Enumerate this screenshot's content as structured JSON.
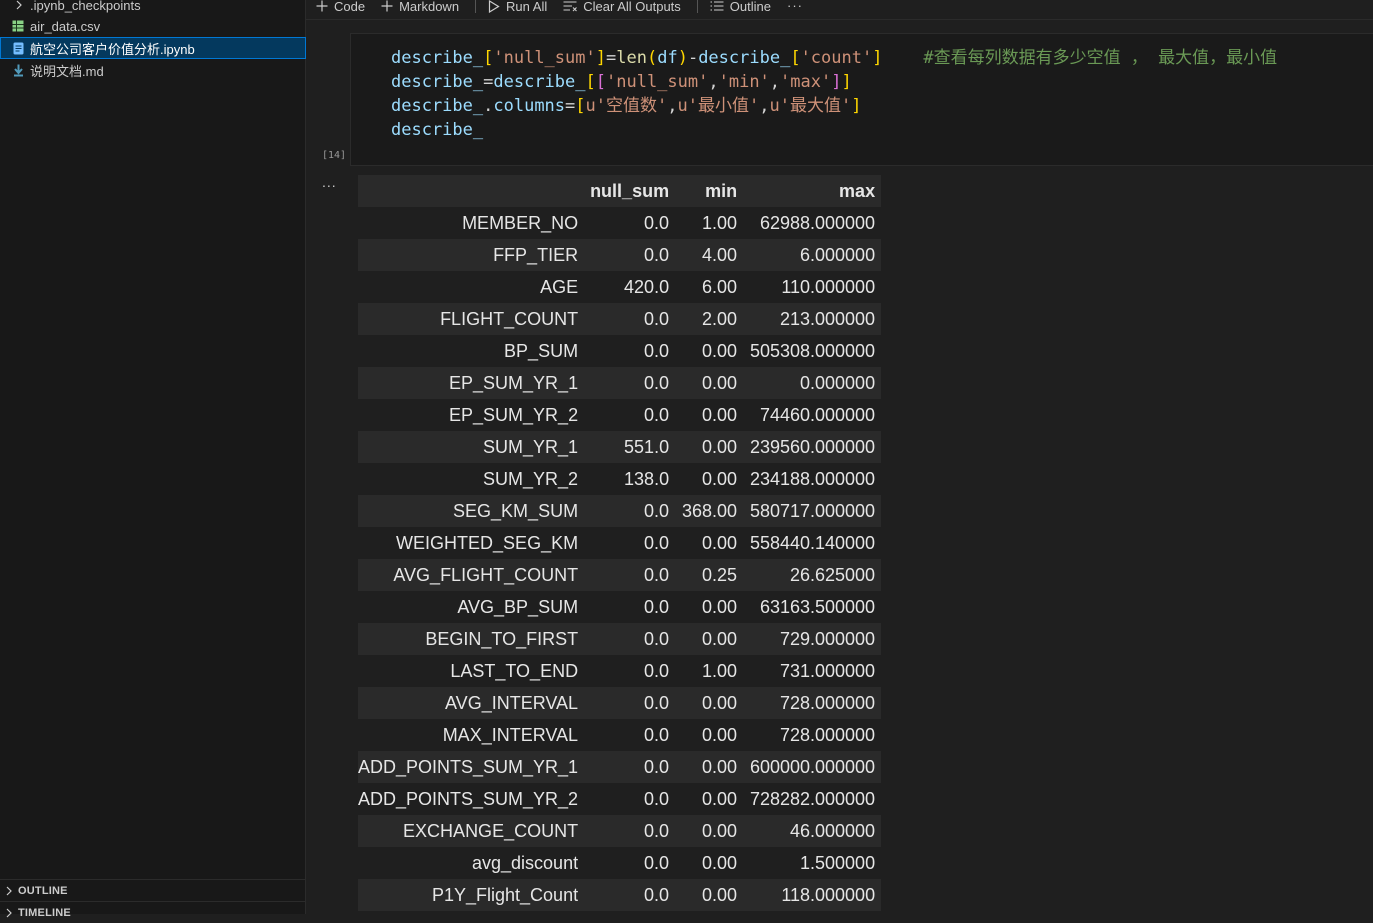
{
  "sidebar": {
    "files": [
      {
        "name": ".ipynb_checkpoints",
        "kind": "folder"
      },
      {
        "name": "air_data.csv",
        "kind": "csv"
      },
      {
        "name": "航空公司客户价值分析.ipynb",
        "kind": "notebook",
        "selected": true
      },
      {
        "name": "说明文档.md",
        "kind": "markdown"
      }
    ],
    "panels": [
      "OUTLINE",
      "TIMELINE"
    ]
  },
  "toolbar": {
    "code": "Code",
    "markdown": "Markdown",
    "run_all": "Run All",
    "clear_all_outputs": "Clear All Outputs",
    "outline": "Outline",
    "more": "···"
  },
  "cell": {
    "exec_count": "[14]",
    "output_menu": "...",
    "code": {
      "l1_a": "describe_",
      "l1_b": "[",
      "l1_c": "'null_sum'",
      "l1_d": "]",
      "l1_e": "=",
      "l1_f": "len",
      "l1_g": "(",
      "l1_h": "df",
      "l1_i": ")",
      "l1_j": "-",
      "l1_k": "describe_",
      "l1_l": "[",
      "l1_m": "'count'",
      "l1_n": "]",
      "l1_comment": "#查看每列数据有多少空值 ， 最大值，最小值",
      "l2_a": "describe_",
      "l2_b": "=",
      "l2_c": "describe_",
      "l2_d": "[",
      "l2_e": "[",
      "l2_f": "'null_sum'",
      "l2_g": ",",
      "l2_h": "'min'",
      "l2_i": ",",
      "l2_j": "'max'",
      "l2_k": "]",
      "l2_l": "]",
      "l3_a": "describe_",
      "l3_b": ".",
      "l3_c": "columns",
      "l3_d": "=",
      "l3_e": "[",
      "l3_f": "u'空值数'",
      "l3_g": ",",
      "l3_h": "u'最小值'",
      "l3_i": ",",
      "l3_j": "u'最大值'",
      "l3_k": "]",
      "l4": "describe_"
    },
    "output": {
      "columns": [
        "",
        "null_sum",
        "min",
        "max"
      ],
      "rows": [
        [
          "MEMBER_NO",
          "0.0",
          "1.00",
          "62988.000000"
        ],
        [
          "FFP_TIER",
          "0.0",
          "4.00",
          "6.000000"
        ],
        [
          "AGE",
          "420.0",
          "6.00",
          "110.000000"
        ],
        [
          "FLIGHT_COUNT",
          "0.0",
          "2.00",
          "213.000000"
        ],
        [
          "BP_SUM",
          "0.0",
          "0.00",
          "505308.000000"
        ],
        [
          "EP_SUM_YR_1",
          "0.0",
          "0.00",
          "0.000000"
        ],
        [
          "EP_SUM_YR_2",
          "0.0",
          "0.00",
          "74460.000000"
        ],
        [
          "SUM_YR_1",
          "551.0",
          "0.00",
          "239560.000000"
        ],
        [
          "SUM_YR_2",
          "138.0",
          "0.00",
          "234188.000000"
        ],
        [
          "SEG_KM_SUM",
          "0.0",
          "368.00",
          "580717.000000"
        ],
        [
          "WEIGHTED_SEG_KM",
          "0.0",
          "0.00",
          "558440.140000"
        ],
        [
          "AVG_FLIGHT_COUNT",
          "0.0",
          "0.25",
          "26.625000"
        ],
        [
          "AVG_BP_SUM",
          "0.0",
          "0.00",
          "63163.500000"
        ],
        [
          "BEGIN_TO_FIRST",
          "0.0",
          "0.00",
          "729.000000"
        ],
        [
          "LAST_TO_END",
          "0.0",
          "1.00",
          "731.000000"
        ],
        [
          "AVG_INTERVAL",
          "0.0",
          "0.00",
          "728.000000"
        ],
        [
          "MAX_INTERVAL",
          "0.0",
          "0.00",
          "728.000000"
        ],
        [
          "ADD_POINTS_SUM_YR_1",
          "0.0",
          "0.00",
          "600000.000000"
        ],
        [
          "ADD_POINTS_SUM_YR_2",
          "0.0",
          "0.00",
          "728282.000000"
        ],
        [
          "EXCHANGE_COUNT",
          "0.0",
          "0.00",
          "46.000000"
        ],
        [
          "avg_discount",
          "0.0",
          "0.00",
          "1.500000"
        ],
        [
          "P1Y_Flight_Count",
          "0.0",
          "0.00",
          "118.000000"
        ]
      ]
    }
  }
}
